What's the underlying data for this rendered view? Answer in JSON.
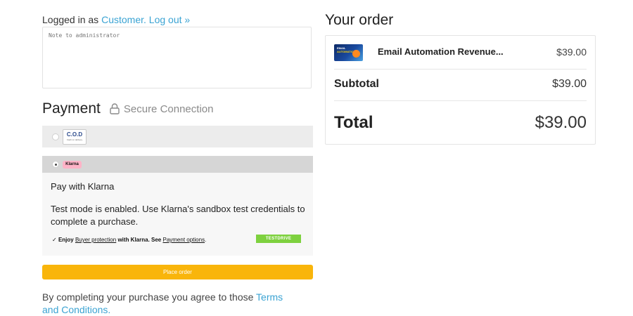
{
  "account": {
    "prefix": "Logged in as",
    "user": "Customer.",
    "logout": "Log out »"
  },
  "note": {
    "placeholder": "Note to administrator"
  },
  "payment": {
    "title": "Payment",
    "secure_label": "Secure Connection",
    "methods": [
      {
        "id": "cod",
        "logo_text": "C.O.D",
        "logo_subtext": "Cash on delivery",
        "selected": false
      },
      {
        "id": "klarna",
        "logo_text": "Klarna",
        "selected": true
      }
    ],
    "klarna": {
      "title": "Pay with Klarna",
      "description": "Test mode is enabled. Use Klarna's sandbox test credentials to complete a purchase.",
      "enjoy_check": "✓",
      "enjoy_prefix": "Enjoy",
      "buyer_protection": "Buyer protection",
      "with_klarna": "with Klarna. See",
      "payment_options": "Payment options",
      "period": ".",
      "badge": "TESTDRIVE"
    },
    "place_order": "Place order"
  },
  "terms": {
    "prefix": "By completing your purchase you agree to those",
    "link": "Terms and Conditions."
  },
  "order": {
    "title": "Your order",
    "item": {
      "thumb_line1": "EMAIL",
      "thumb_line2": "AUTOMATION",
      "name": "Email Automation Revenue...",
      "price": "$39.00"
    },
    "subtotal_label": "Subtotal",
    "subtotal_value": "$39.00",
    "total_label": "Total",
    "total_value": "$39.00"
  },
  "colors": {
    "link": "#3aa3d3",
    "place_order": "#f9b50b",
    "testdrive": "#7ed13f",
    "klarna_pink": "#ffb3c7"
  },
  "icons": {
    "secure": "lock-icon",
    "check": "checkmark-icon"
  }
}
